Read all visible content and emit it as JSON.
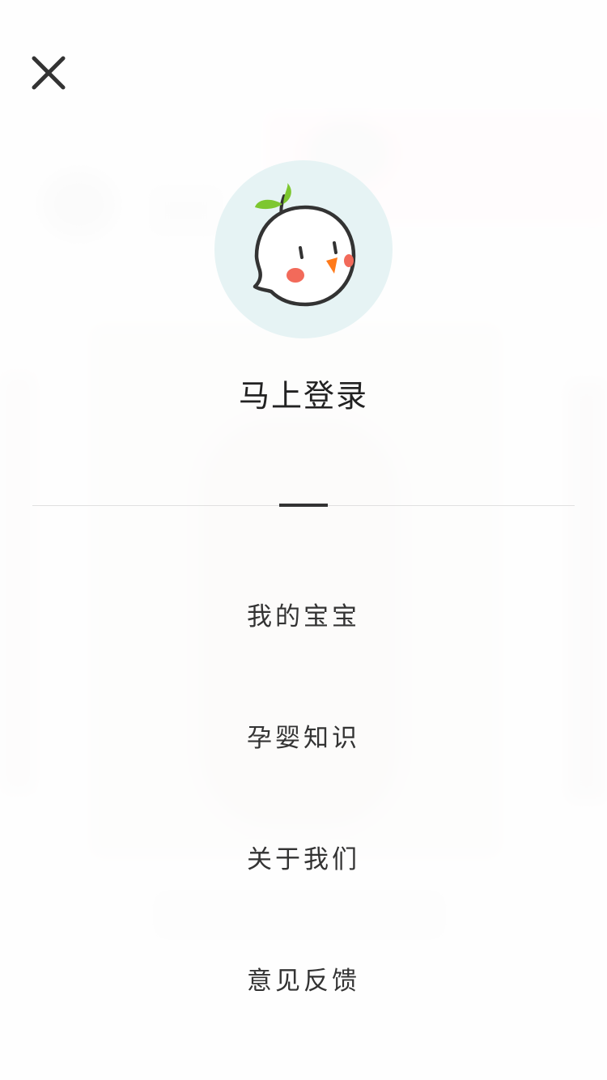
{
  "login": {
    "title": "马上登录"
  },
  "menu": {
    "items": [
      {
        "label": "我的宝宝"
      },
      {
        "label": "孕婴知识"
      },
      {
        "label": "关于我们"
      },
      {
        "label": "意见反馈"
      }
    ]
  },
  "icons": {
    "close": "close-icon",
    "avatar": "mascot-avatar-icon"
  },
  "colors": {
    "avatar_bg": "#e6f3f4",
    "text": "#333333",
    "title": "#222222",
    "sprout": "#7dc72f",
    "cheek": "#f26a5a",
    "beak": "#ff7a1a"
  }
}
